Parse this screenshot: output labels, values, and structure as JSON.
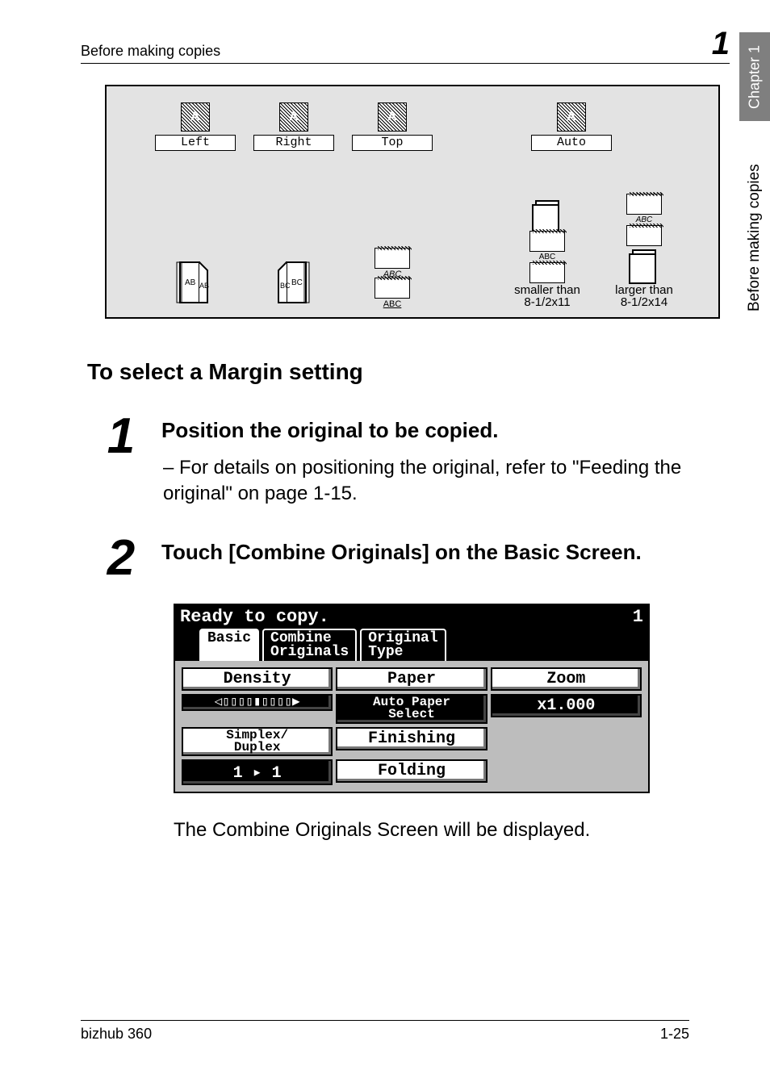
{
  "header": {
    "left": "Before making copies",
    "right": "1"
  },
  "side": {
    "chapter": "Chapter 1",
    "label": "Before making copies"
  },
  "diagram": {
    "options": [
      "Left",
      "Right",
      "Top",
      "Auto"
    ],
    "smaller_caption_l1": "smaller than",
    "smaller_caption_l2": "8-1/2x11",
    "larger_caption_l1": "larger than",
    "larger_caption_l2": "8-1/2x14",
    "abc": "ABC",
    "ab": "AB",
    "bc": "BC"
  },
  "section_title": "To select a Margin setting",
  "steps": [
    {
      "num": "1",
      "heading": "Position the original to be copied.",
      "sub": "– For details on positioning the original, refer to \"Feeding the original\" on page 1-15."
    },
    {
      "num": "2",
      "heading": "Touch [Combine Originals] on the Basic Screen.",
      "sub": ""
    }
  ],
  "lcd": {
    "status": "Ready to copy.",
    "count": "1",
    "tabs": [
      "Basic",
      "Combine\nOriginals",
      "Original\nType"
    ],
    "density": "Density",
    "paper": "Paper",
    "zoom": "Zoom",
    "auto_paper": "Auto Paper\nSelect",
    "zoom_val": "x1.000",
    "simplex": "Simplex/\nDuplex",
    "finishing": "Finishing",
    "one_to_one": "1 ▸ 1",
    "folding": "Folding"
  },
  "followup": "The Combine Originals Screen will be displayed.",
  "footer": {
    "left": "bizhub 360",
    "right": "1-25"
  }
}
